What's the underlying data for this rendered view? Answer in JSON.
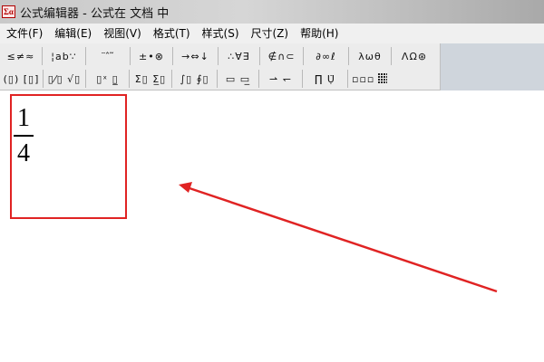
{
  "window": {
    "icon_glyph": "Σα",
    "title": "公式编辑器 - 公式在 文档 中"
  },
  "menu": [
    {
      "label": "文件(F)"
    },
    {
      "label": "编辑(E)"
    },
    {
      "label": "视图(V)"
    },
    {
      "label": "格式(T)"
    },
    {
      "label": "样式(S)"
    },
    {
      "label": "尺寸(Z)"
    },
    {
      "label": "帮助(H)"
    }
  ],
  "toolbar": {
    "row1": [
      {
        "name": "relations-palette",
        "glyphs": "≤≠≈"
      },
      {
        "name": "spaces-palette",
        "glyphs": "¦ab∵"
      },
      {
        "name": "embellishments-palette",
        "glyphs": "¨ ̂ ̃"
      },
      {
        "name": "operators-palette",
        "glyphs": "±•⊗"
      },
      {
        "name": "arrows-palette",
        "glyphs": "→⇔↓"
      },
      {
        "name": "logic-palette",
        "glyphs": "∴∀∃"
      },
      {
        "name": "set-theory-palette",
        "glyphs": "∉∩⊂"
      },
      {
        "name": "misc-symbols-palette",
        "glyphs": "∂∞ℓ"
      },
      {
        "name": "greek-lower-palette",
        "glyphs": "λωθ"
      },
      {
        "name": "greek-upper-palette",
        "glyphs": "ΛΩ⊛"
      }
    ],
    "row2": [
      {
        "name": "fences-palette",
        "glyphs": "(▯) [▯]"
      },
      {
        "name": "fraction-radical-palette",
        "glyphs": "▯⁄▯ √▯"
      },
      {
        "name": "subscript-superscript-palette",
        "glyphs": "▯ˣ ▯̲"
      },
      {
        "name": "summation-palette",
        "glyphs": "Σ▯ Σ̲▯"
      },
      {
        "name": "integral-palette",
        "glyphs": "∫▯ ∮▯"
      },
      {
        "name": "underbar-overbar-palette",
        "glyphs": "▭ ▭̲"
      },
      {
        "name": "labeled-arrows-palette",
        "glyphs": "⇀ ↽"
      },
      {
        "name": "products-palette",
        "glyphs": "∏̈ Ụ̈"
      },
      {
        "name": "matrices-palette",
        "glyphs": "▫▫▫"
      }
    ]
  },
  "document": {
    "fraction": {
      "numerator": "1",
      "denominator": "4"
    }
  },
  "colors": {
    "annotation_red": "#e02323"
  }
}
